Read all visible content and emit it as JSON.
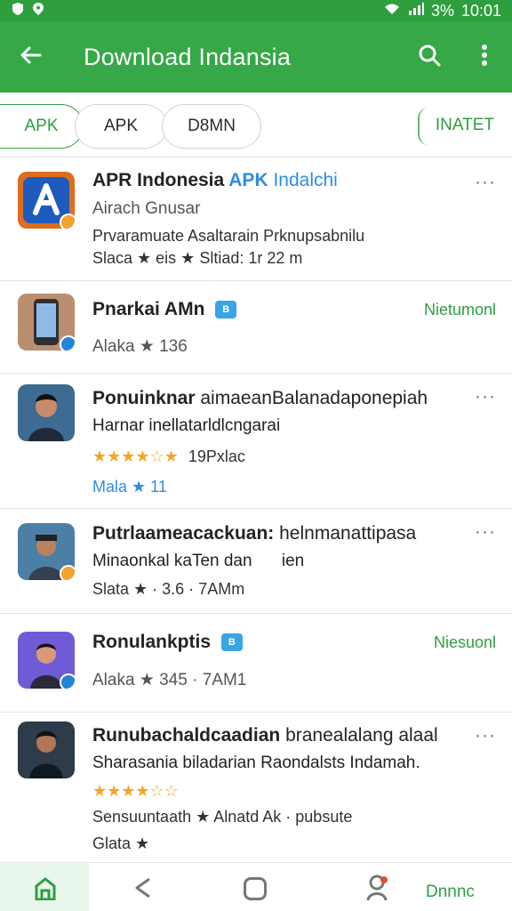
{
  "status": {
    "left_icons": [
      "shield-icon",
      "location-icon"
    ],
    "battery": "3%",
    "time": "10:01"
  },
  "app": {
    "title": "Download Indansia",
    "icons": [
      "back-arrow-icon",
      "search-icon",
      "more-vert-icon"
    ]
  },
  "tabs": {
    "items": [
      "APK",
      "APK",
      "D8MN"
    ],
    "right_label": "INATET"
  },
  "feed": {
    "items": [
      {
        "title": "APR Indonesia",
        "title_tag": "APK",
        "title_suffix": "Indalchi",
        "line2": "Airach Gnusar",
        "line3": "Prvaramuate Asaltarain Prknupsabnilu",
        "line4": "Slaca ★ eis ★ Sltiad: 1r 22 m",
        "more": "···",
        "avatar": "apk-icon"
      },
      {
        "title": "Pnarkai AMn",
        "title_badge": "B",
        "line2": "Alaka ★ 136",
        "action": "Nietumonl",
        "avatar": "phone-icon"
      },
      {
        "title": "Ponuinknar",
        "title_suffix": "aimaeanBalanadaponepiah",
        "line2": "Harnar inellatarldlcngarai",
        "stars": "★★★★☆★",
        "line3": "19Pxlac",
        "line4": "Mala ★ 11",
        "more": "···",
        "avatar": "person-icon"
      },
      {
        "title": "Putrlaameacackuan:",
        "title_suffix": "helnmanattipasa",
        "line2": "Minaonkal kaTen dan",
        "line2_suffix": "ien",
        "line3": "Slata ★ · 3.6 · 7AMm",
        "more": "···",
        "avatar": "person-icon"
      },
      {
        "title": "Ronulankptis",
        "title_badge": "B",
        "line2": "Alaka ★ 345 · 7AM1",
        "action": "Niesuonl",
        "avatar": "person-icon"
      },
      {
        "title": "Runubachaldcaadian",
        "title_suffix": "branealalang alaal",
        "line2": "Sharasania biladarian Raondalsts Indamah.",
        "stars": "★★★★☆☆",
        "line3": "Sensuuntaath ★ Alnatd Ak · pubsute",
        "line4": "Glata ★",
        "more": "···",
        "avatar": "person-icon"
      }
    ]
  },
  "bottom": {
    "icons": [
      "home-icon",
      "back-triangle-icon",
      "square-icon",
      "profile-icon"
    ],
    "label": "Dnnnc"
  },
  "colors": {
    "green": "#36a847",
    "blue": "#2385d8",
    "orange": "#f2a22d"
  }
}
